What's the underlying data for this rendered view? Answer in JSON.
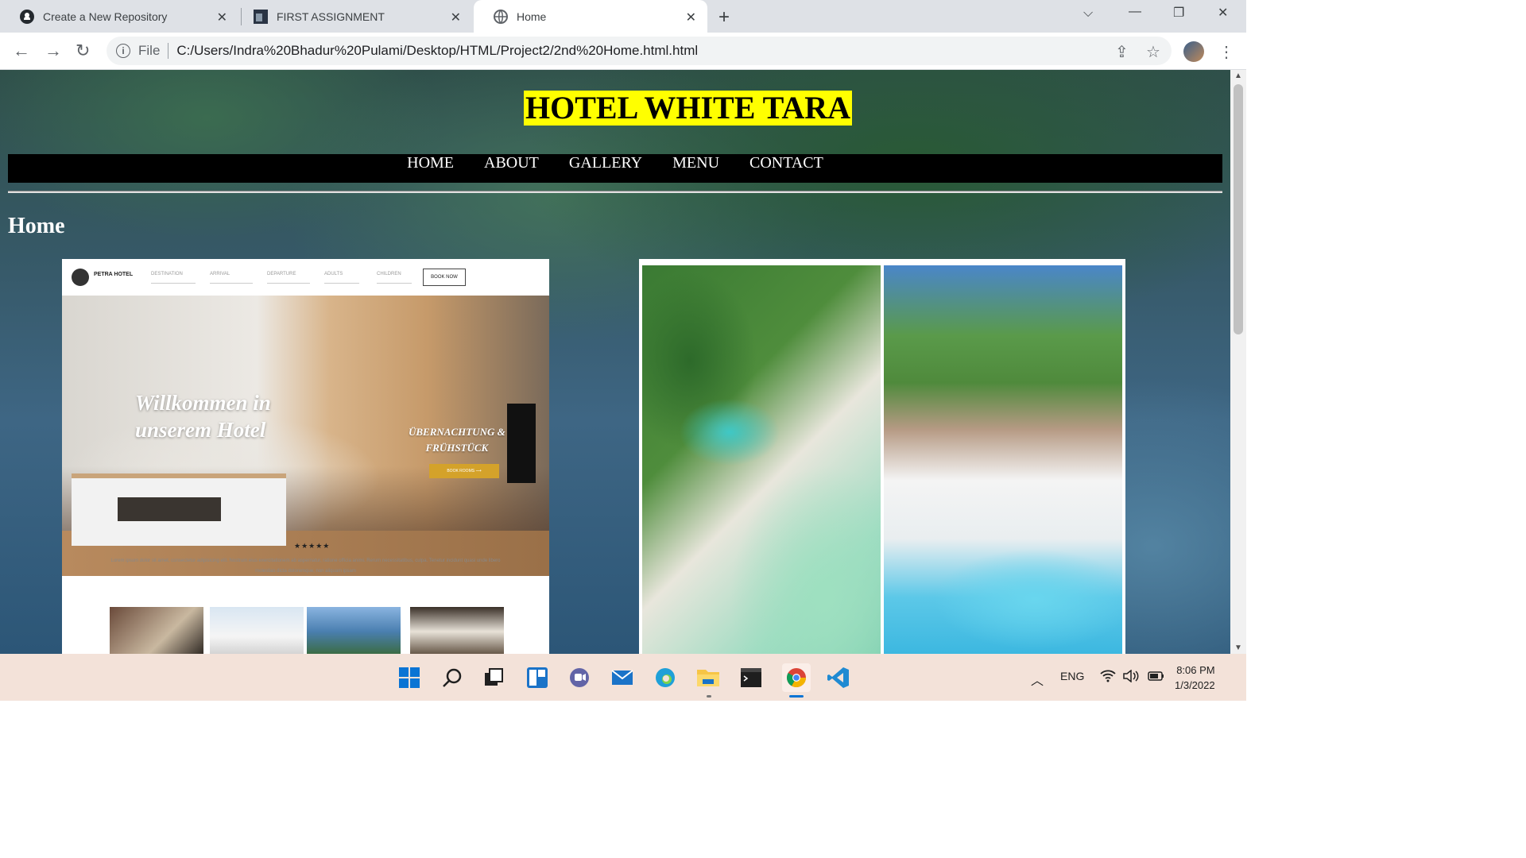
{
  "browser": {
    "tabs": [
      {
        "title": "Create a New Repository",
        "icon": "github-icon",
        "active": false
      },
      {
        "title": "FIRST ASSIGNMENT",
        "icon": "page-thumb-icon",
        "active": false
      },
      {
        "title": "Home",
        "icon": "globe-icon",
        "active": true
      }
    ],
    "address": {
      "scheme_label": "File",
      "url": "C:/Users/Indra%20Bhadur%20Pulami/Desktop/HTML/Project2/2nd%20Home.html.html"
    }
  },
  "site": {
    "title": "HOTEL WHITE TARA",
    "nav": [
      "HOME",
      "ABOUT",
      "GALLERY",
      "MENU",
      "CONTACT"
    ],
    "heading": "Home",
    "title_bg": "#ffff00"
  },
  "image1": {
    "brand": "PETRA HOTEL",
    "fields": [
      "DESTINATION",
      "ARRIVAL",
      "DEPARTURE",
      "ADULTS",
      "CHILDREN"
    ],
    "book_button": "BOOK NOW",
    "welcome_line1": "Willkommen in",
    "welcome_line2": "unserem Hotel",
    "subtitle_line1": "ÜBERNACHTUNG &",
    "subtitle_line2": "FRÜHSTÜCK",
    "cta": "BOOK ROOMS ⟶",
    "stars": "★★★★★",
    "lorem": "Lorem ipsum dolor sit amet, consectetur adipisicing elit. Nostrum eius exercitationem ab aspernatur, ratione officia animi. Rerum necessitatibus, culpa. Tenetur incidunt quasi unde libero molestias dicta doloremque, non aliquam ipsam"
  },
  "taskbar": {
    "language": "ENG",
    "time": "8:06 PM",
    "date": "1/3/2022"
  }
}
